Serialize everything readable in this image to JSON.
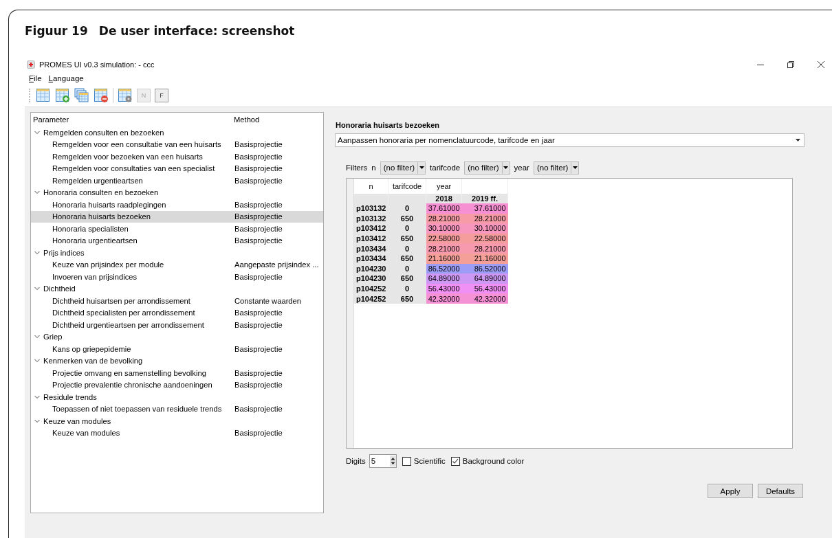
{
  "figure": {
    "number": "Figuur 19",
    "caption": "De user interface: screenshot"
  },
  "window": {
    "title": "PROMES UI v0.3 simulation: - ccc"
  },
  "menu": [
    {
      "label": "File"
    },
    {
      "label": "Language"
    }
  ],
  "toolbar": [
    {
      "kind": "table"
    },
    {
      "kind": "table-add"
    },
    {
      "kind": "table-copy"
    },
    {
      "kind": "table-remove"
    },
    {
      "kind": "table-settings"
    },
    {
      "kind": "letter",
      "label": "N",
      "disabled": true
    },
    {
      "kind": "letter",
      "label": "F",
      "disabled": false
    }
  ],
  "tree": {
    "columns": [
      "Parameter",
      "Method"
    ],
    "groups": [
      {
        "label": "Remgelden consulten en bezoeken",
        "expanded": true,
        "children": [
          {
            "name": "Remgelden voor een consultatie van een huisarts",
            "method": "Basisprojectie",
            "selected": false
          },
          {
            "name": "Remgelden voor bezoeken van een huisarts",
            "method": "Basisprojectie",
            "selected": false
          },
          {
            "name": "Remgelden voor consultaties van een specialist",
            "method": "Basisprojectie",
            "selected": false
          },
          {
            "name": "Remgelden urgentieartsen",
            "method": "Basisprojectie",
            "selected": false
          }
        ]
      },
      {
        "label": "Honoraria consulten en bezoeken",
        "expanded": true,
        "children": [
          {
            "name": "Honoraria huisarts raadplegingen",
            "method": "Basisprojectie",
            "selected": false
          },
          {
            "name": "Honoraria huisarts bezoeken",
            "method": "Basisprojectie",
            "selected": true
          },
          {
            "name": "Honoraria specialisten",
            "method": "Basisprojectie",
            "selected": false
          },
          {
            "name": "Honoraria urgentieartsen",
            "method": "Basisprojectie",
            "selected": false
          }
        ]
      },
      {
        "label": "Prijs indices",
        "expanded": true,
        "children": [
          {
            "name": "Keuze van prijsindex per module",
            "method": "Aangepaste prijsindex ...",
            "selected": false
          },
          {
            "name": "Invoeren van prijsindices",
            "method": "Basisprojectie",
            "selected": false
          }
        ]
      },
      {
        "label": "Dichtheid",
        "expanded": true,
        "children": [
          {
            "name": "Dichtheid huisartsen per arrondissement",
            "method": "Constante waarden",
            "selected": false
          },
          {
            "name": "Dichtheid specialisten per arrondissement",
            "method": "Basisprojectie",
            "selected": false
          },
          {
            "name": "Dichtheid urgentieartsen per arrondissement",
            "method": "Basisprojectie",
            "selected": false
          }
        ]
      },
      {
        "label": "Griep",
        "expanded": true,
        "children": [
          {
            "name": "Kans op griepepidemie",
            "method": "Basisprojectie",
            "selected": false
          }
        ]
      },
      {
        "label": "Kenmerken van de bevolking",
        "expanded": true,
        "children": [
          {
            "name": "Projectie omvang en samenstelling bevolking",
            "method": "Basisprojectie",
            "selected": false
          },
          {
            "name": "Projectie prevalentie chronische aandoeningen",
            "method": "Basisprojectie",
            "selected": false
          }
        ]
      },
      {
        "label": "Residule trends",
        "expanded": true,
        "children": [
          {
            "name": "Toepassen of niet toepassen van residuele trends",
            "method": "Basisprojectie",
            "selected": false
          }
        ]
      },
      {
        "label": "Keuze van modules",
        "expanded": true,
        "children": [
          {
            "name": "Keuze van modules",
            "method": "Basisprojectie",
            "selected": false
          }
        ]
      }
    ]
  },
  "detail": {
    "title": "Honoraria huisarts bezoeken",
    "method_dropdown": "Aanpassen honoraria per nomenclatuurcode, tarifcode en jaar",
    "filters": {
      "label": "Filters",
      "items": [
        {
          "name": "n",
          "value": "(no filter)"
        },
        {
          "name": "tarifcode",
          "value": "(no filter)"
        },
        {
          "name": "year",
          "value": "(no filter)"
        }
      ]
    },
    "table": {
      "headers": [
        "n",
        "tarifcode",
        "year"
      ],
      "years": [
        "2018",
        "2019 ff."
      ],
      "rows": [
        {
          "n": "p103132",
          "tarifcode": "0",
          "values": [
            "37.61000",
            "37.61000"
          ],
          "color": "#f790d2"
        },
        {
          "n": "p103132",
          "tarifcode": "650",
          "values": [
            "28.21000",
            "28.21000"
          ],
          "color": "#f79ca6"
        },
        {
          "n": "p103412",
          "tarifcode": "0",
          "values": [
            "30.10000",
            "30.10000"
          ],
          "color": "#f797bd"
        },
        {
          "n": "p103412",
          "tarifcode": "650",
          "values": [
            "22.58000",
            "22.58000"
          ],
          "color": "#f59c9c"
        },
        {
          "n": "p103434",
          "tarifcode": "0",
          "values": [
            "28.21000",
            "28.21000"
          ],
          "color": "#f79aae"
        },
        {
          "n": "p103434",
          "tarifcode": "650",
          "values": [
            "21.16000",
            "21.16000"
          ],
          "color": "#f49f98"
        },
        {
          "n": "p104230",
          "tarifcode": "0",
          "values": [
            "86.52000",
            "86.52000"
          ],
          "color": "#9b9df6"
        },
        {
          "n": "p104230",
          "tarifcode": "650",
          "values": [
            "64.89000",
            "64.89000"
          ],
          "color": "#cc98f4"
        },
        {
          "n": "p104252",
          "tarifcode": "0",
          "values": [
            "56.43000",
            "56.43000"
          ],
          "color": "#f08ff4"
        },
        {
          "n": "p104252",
          "tarifcode": "650",
          "values": [
            "42.32000",
            "42.32000"
          ],
          "color": "#f592d6"
        }
      ]
    },
    "digits": {
      "label": "Digits",
      "value": "5"
    },
    "options": [
      {
        "label": "Scientific",
        "checked": false
      },
      {
        "label": "Background color",
        "checked": true
      }
    ],
    "buttons": [
      "Apply",
      "Defaults"
    ]
  }
}
